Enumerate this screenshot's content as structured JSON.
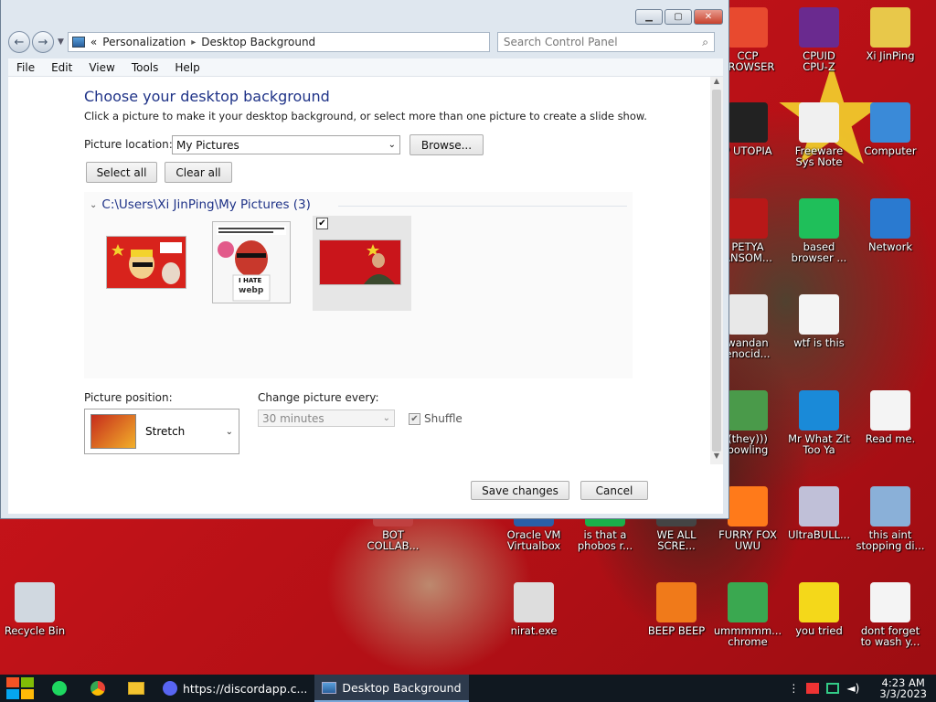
{
  "window": {
    "nav": {
      "breadcrumb_chevron": "«",
      "breadcrumb_1": "Personalization",
      "breadcrumb_sep": "▸",
      "breadcrumb_2": "Desktop Background",
      "search_placeholder": "Search Control Panel"
    },
    "menu": [
      "File",
      "Edit",
      "View",
      "Tools",
      "Help"
    ],
    "heading": "Choose your desktop background",
    "subheading": "Click a picture to make it your desktop background, or select more than one picture to create a slide show.",
    "picture_location_label": "Picture location:",
    "picture_location_value": "My Pictures",
    "browse_label": "Browse...",
    "select_all_label": "Select all",
    "clear_all_label": "Clear all",
    "group_title": "C:\\Users\\Xi JinPing\\My Pictures (3)",
    "thumb2_caption": "I HATE",
    "thumb2_brand": "webp",
    "picture_position_label": "Picture position:",
    "picture_position_value": "Stretch",
    "change_every_label": "Change picture every:",
    "change_every_value": "30 minutes",
    "shuffle_label": "Shuffle",
    "save_label": "Save changes",
    "cancel_label": "Cancel"
  },
  "desktop_icons": [
    {
      "label": "CCP\nBROWSER",
      "color": "#e84a2f"
    },
    {
      "label": "CPUID\nCPU-Z",
      "color": "#6a2a8f"
    },
    {
      "label": "Xi JinPing",
      "color": "#e8c84a"
    },
    {
      "label": "P UTOPIA",
      "color": "#222222"
    },
    {
      "label": "Freeware\nSys Note",
      "color": "#f0f0f0"
    },
    {
      "label": "Computer",
      "color": "#3a8ad8"
    },
    {
      "label": "PETYA\nANSOM...",
      "color": "#b81818"
    },
    {
      "label": "based\nbrowser ...",
      "color": "#1fbf5a"
    },
    {
      "label": "Network",
      "color": "#2a7ad0"
    },
    {
      "label": "wandan\nenocid...",
      "color": "#e8e8e8"
    },
    {
      "label": "wtf is this",
      "color": "#f4f4f4"
    },
    {
      "label": "(they)))\nbowling",
      "color": "#4a9a4a"
    },
    {
      "label": "Mr What Zit\nToo Ya",
      "color": "#1a8ad8"
    },
    {
      "label": "Read me.",
      "color": "#f4f4f4"
    },
    {
      "label": "BOT\nCOLLAB...",
      "color": "#c04040"
    },
    {
      "label": "Oracle VM\nVirtualbox",
      "color": "#2a5fa8"
    },
    {
      "label": "is that a\nphobos r...",
      "color": "#1ab04a"
    },
    {
      "label": "WE ALL\nSCRE...",
      "color": "#444444"
    },
    {
      "label": "FURRY FOX\nUWU",
      "color": "#ff7a1a"
    },
    {
      "label": "UltraBULL...",
      "color": "#c0c0d8"
    },
    {
      "label": "this aint\nstopping di...",
      "color": "#8ab0d8"
    },
    {
      "label": "Recycle Bin",
      "color": "#d0d8e0"
    },
    {
      "label": "nirat.exe",
      "color": "#dddddd"
    },
    {
      "label": "BEEP BEEP",
      "color": "#f07a1a"
    },
    {
      "label": "ummmmm...\nchrome",
      "color": "#3aa850"
    },
    {
      "label": "you tried",
      "color": "#f4d81a"
    },
    {
      "label": "dont forget\nto wash y...",
      "color": "#f4f4f4"
    }
  ],
  "taskbar": {
    "task1": "https://discordapp.c...",
    "task2": "Desktop Background",
    "time": "4:23 AM",
    "date": "3/3/2023"
  }
}
